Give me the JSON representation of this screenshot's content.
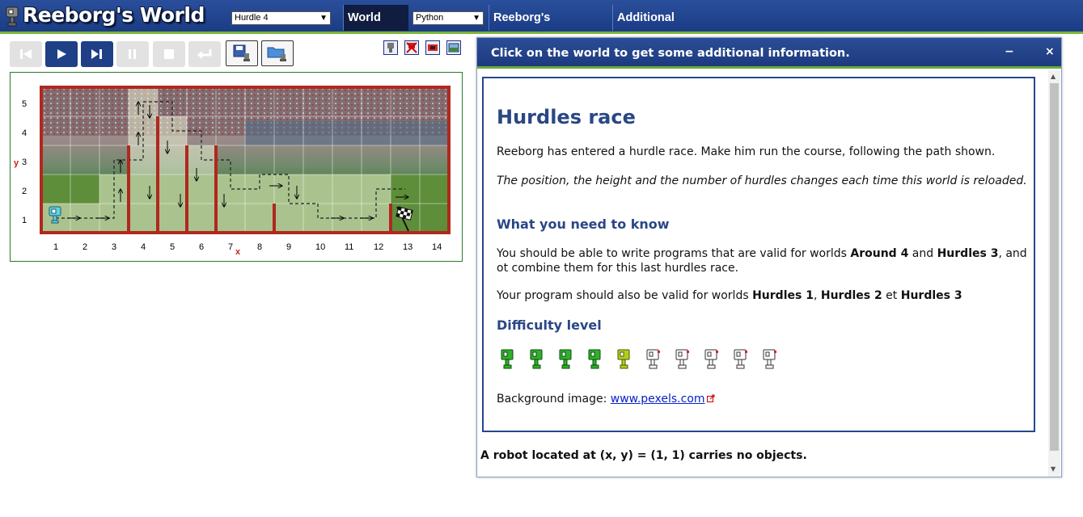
{
  "app": {
    "title": "Reeborg's World",
    "world_select": "Hurdle 4",
    "language_select": "Python",
    "menu": {
      "world_info": "World info",
      "keyboard": "Reeborg's keyboard",
      "options": "Additional options"
    }
  },
  "toolbar": {
    "buttons": [
      "reload-button",
      "run-button",
      "step-button",
      "pause-button",
      "stop-button",
      "return-button",
      "save-button",
      "open-button"
    ]
  },
  "world": {
    "x_axis_name": "x",
    "y_axis_name": "y",
    "x_ticks": [
      "1",
      "2",
      "3",
      "4",
      "5",
      "6",
      "7",
      "8",
      "9",
      "10",
      "11",
      "12",
      "13",
      "14"
    ],
    "y_ticks": [
      "5",
      "4",
      "3",
      "2",
      "1"
    ]
  },
  "dialog": {
    "title": "Click on the world to get some additional information.",
    "minimize": "−",
    "close": "×",
    "heading": "Hurdles race",
    "intro": "Reeborg has entered a hurdle race. Make him run the course, following the path shown.",
    "note": "The position, the height and the number of hurdles changes each time this world is reloaded.",
    "need_heading": "What you need to know",
    "need_text_1a": "You should be able to write programs that are valid for worlds ",
    "need_bold_1": "Around 4",
    "need_text_1b": " and ",
    "need_bold_2": "Hurdles 3",
    "need_text_1c": ", and ot combine them for this last hurdles race.",
    "need_text_2a": "Your program should also be valid for worlds ",
    "need_bold_3": "Hurdles 1",
    "need_text_2b": ", ",
    "need_bold_4": "Hurdles 2",
    "need_text_2c": " et ",
    "need_bold_5": "Hurdles 3",
    "difficulty_heading": "Difficulty level",
    "difficulty_level": 4.5,
    "difficulty_max": 10,
    "background_label": "Background image: ",
    "background_link": "www.pexels.com",
    "status": "A robot located at (x, y) = (1, 1) carries no objects."
  }
}
